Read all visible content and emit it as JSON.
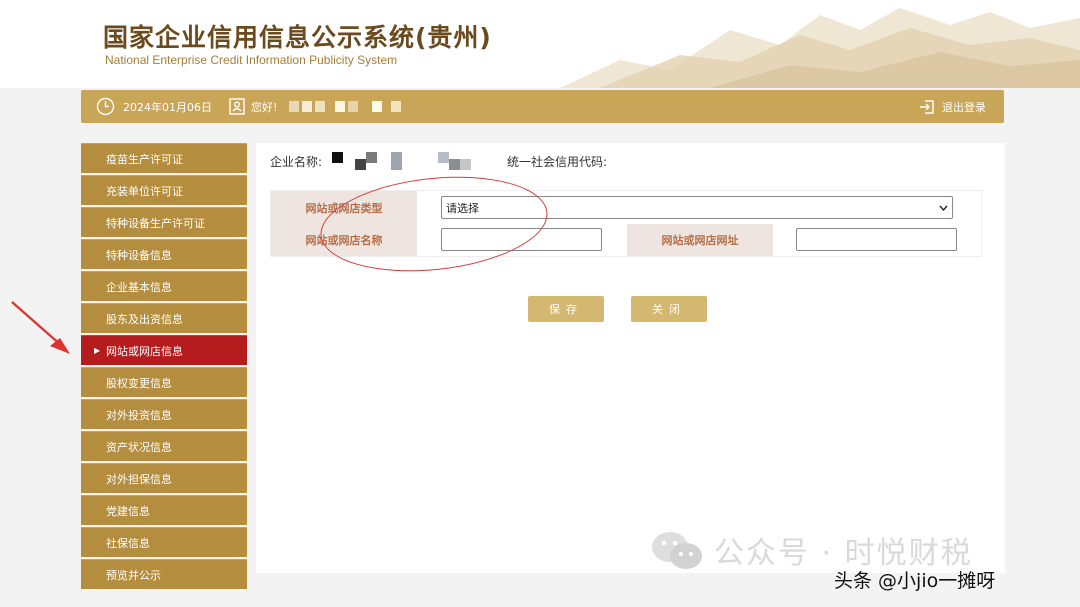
{
  "header": {
    "title_cn": "国家企业信用信息公示系统(贵州)",
    "title_en": "National Enterprise Credit Information Publicity System"
  },
  "topbar": {
    "date": "2024年01月06日",
    "greeting": "您好!",
    "logout": "退出登录"
  },
  "sidebar": {
    "items": [
      {
        "label": "疫苗生产许可证",
        "active": false
      },
      {
        "label": "充装单位许可证",
        "active": false
      },
      {
        "label": "特种设备生产许可证",
        "active": false
      },
      {
        "label": "特种设备信息",
        "active": false
      },
      {
        "label": "企业基本信息",
        "active": false
      },
      {
        "label": "股东及出资信息",
        "active": false
      },
      {
        "label": "网站或网店信息",
        "active": true
      },
      {
        "label": "股权变更信息",
        "active": false
      },
      {
        "label": "对外投资信息",
        "active": false
      },
      {
        "label": "资产状况信息",
        "active": false
      },
      {
        "label": "对外担保信息",
        "active": false
      },
      {
        "label": "党建信息",
        "active": false
      },
      {
        "label": "社保信息",
        "active": false
      },
      {
        "label": "预览并公示",
        "active": false
      }
    ]
  },
  "main": {
    "company_label": "企业名称:",
    "credit_code_label": "统一社会信用代码:",
    "form": {
      "type_label": "网站或网店类型",
      "type_select_value": "请选择",
      "name_label": "网站或网店名称",
      "name_value": "",
      "url_label": "网站或网店网址",
      "url_value": ""
    },
    "save_button": "保存",
    "close_button": "关闭"
  },
  "overlay": {
    "watermark": "公众号 · 时悦财税",
    "credit": "头条 @小jio一摊呀"
  },
  "colors": {
    "brand_gold": "#c9a558",
    "sidebar_gold": "#b48d3f",
    "active_red": "#b41c1e",
    "annotation_red": "#d63a3a"
  }
}
